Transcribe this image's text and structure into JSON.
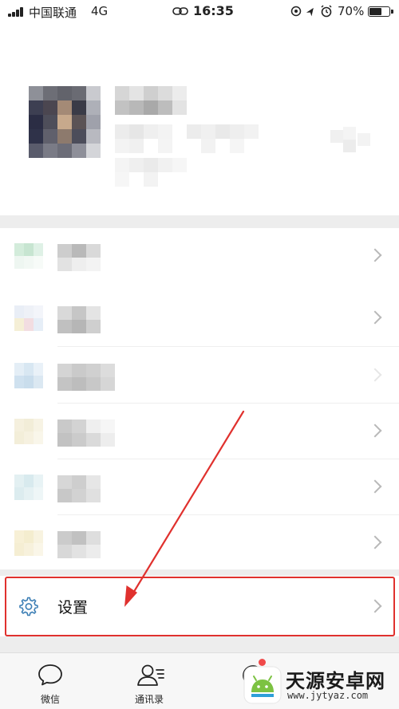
{
  "status_bar": {
    "carrier": "中国联通",
    "network": "4G",
    "time": "16:35",
    "battery": "70%",
    "battery_level": 0.7
  },
  "profile": {
    "avatar": "avatar-pixelated",
    "name": "",
    "id": ""
  },
  "menu": {
    "items": [
      {
        "name": "menu-item-1",
        "icon_color": "#cde8d6"
      },
      {
        "name": "menu-item-2",
        "icon_color": "#e8eef6"
      },
      {
        "name": "menu-item-3",
        "icon_color": "#d6e6f2"
      },
      {
        "name": "menu-item-4",
        "icon_color": "#f3eedc"
      },
      {
        "name": "menu-item-5",
        "icon_color": "#dbecf0"
      },
      {
        "name": "menu-item-6",
        "icon_color": "#f6efd4"
      }
    ],
    "settings_label": "设置",
    "settings_icon": "gear-icon"
  },
  "annotation": {
    "highlight_color": "#e0312e"
  },
  "tab_bar": {
    "tabs": [
      {
        "label": "微信",
        "icon": "chat-bubble-icon"
      },
      {
        "label": "通讯录",
        "icon": "contacts-icon"
      },
      {
        "label": "",
        "icon": "discover-icon"
      }
    ]
  },
  "watermark": {
    "title": "天源安卓网",
    "url": "www.jytyaz.com"
  }
}
